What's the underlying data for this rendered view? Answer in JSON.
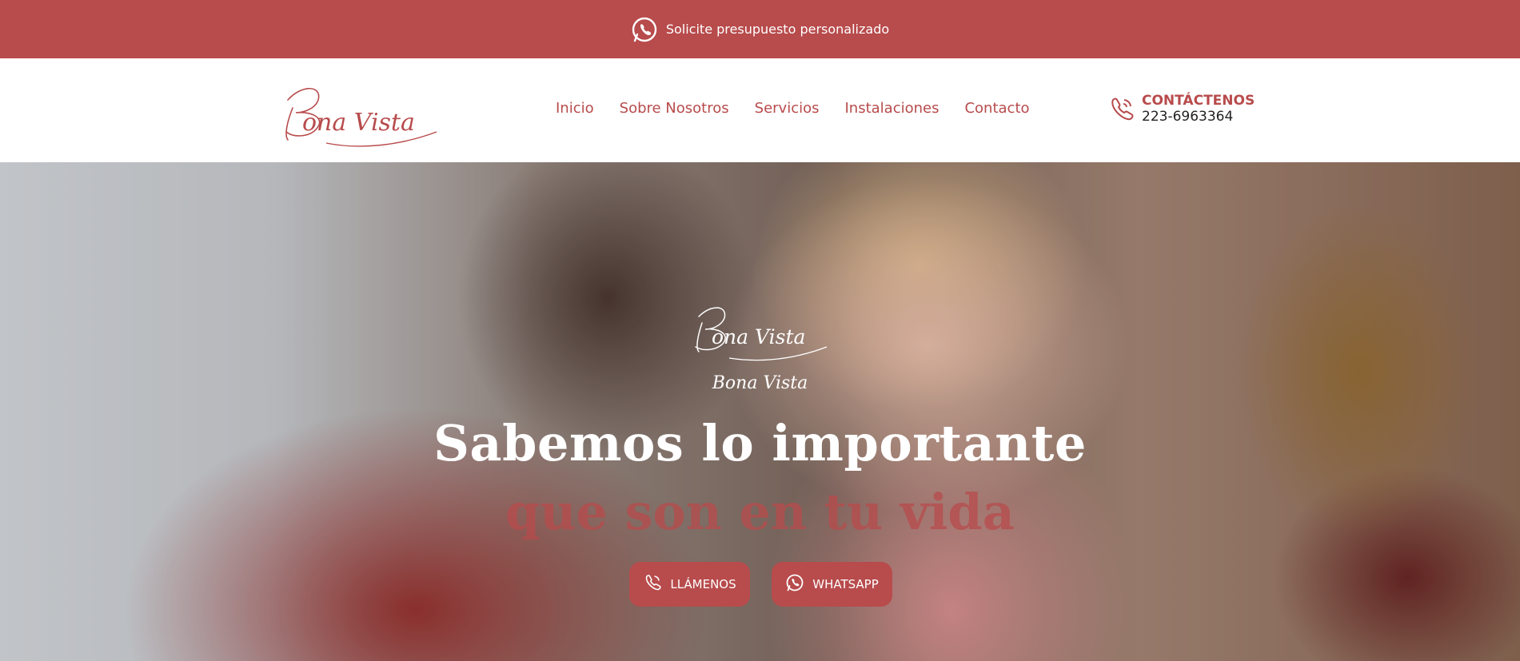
{
  "topbar": {
    "text": "Solicite presupuesto personalizado",
    "icon": "whatsapp-icon"
  },
  "header": {
    "logo_text": "Bona Vista",
    "nav": [
      {
        "label": "Inicio"
      },
      {
        "label": "Sobre Nosotros"
      },
      {
        "label": "Servicios"
      },
      {
        "label": "Instalaciones"
      },
      {
        "label": "Contacto"
      }
    ],
    "contact": {
      "title": "CONTÁCTENOS",
      "phone": "223-6963364",
      "icon": "phone-icon"
    }
  },
  "hero": {
    "logo_text": "Bona Vista",
    "brand": "Bona Vista",
    "headline": "Sabemos lo importante",
    "subheadline": "que son en tu vida",
    "buttons": [
      {
        "label": "LLÁMENOS",
        "icon": "phone-icon"
      },
      {
        "label": "WHATSAPP",
        "icon": "whatsapp-icon"
      }
    ]
  },
  "colors": {
    "accent": "#b84b4c",
    "text_dark": "#222222",
    "white": "#ffffff"
  }
}
